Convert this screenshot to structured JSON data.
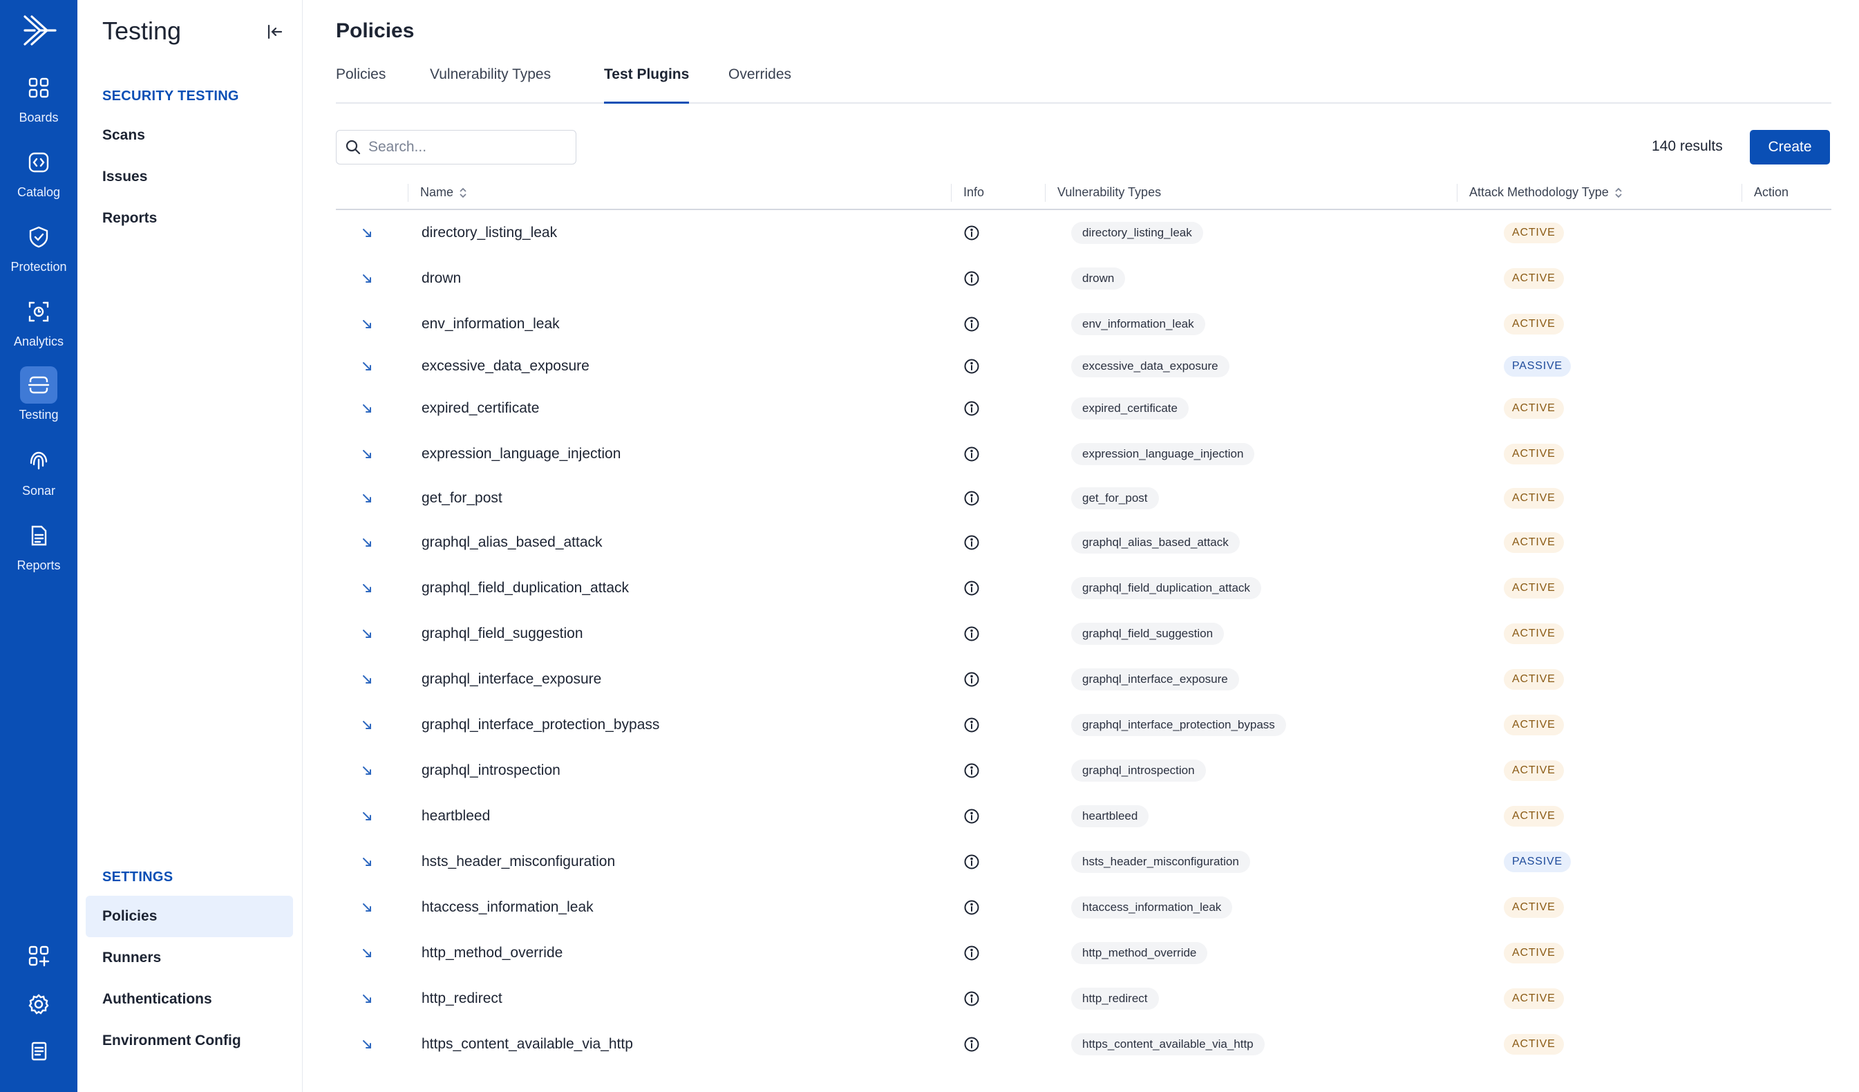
{
  "rail": {
    "items": [
      {
        "label": "Boards",
        "icon": "grid-icon"
      },
      {
        "label": "Catalog",
        "icon": "catalog-icon"
      },
      {
        "label": "Protection",
        "icon": "shield-icon"
      },
      {
        "label": "Analytics",
        "icon": "analytics-icon"
      },
      {
        "label": "Testing",
        "icon": "testing-icon",
        "active": true
      },
      {
        "label": "Sonar",
        "icon": "fingerprint-icon"
      },
      {
        "label": "Reports",
        "icon": "document-icon"
      }
    ],
    "bottom": [
      "apps-add-icon",
      "gear-icon",
      "notes-icon"
    ]
  },
  "sidebar": {
    "title": "Testing",
    "section1": "SECURITY TESTING",
    "items1": [
      "Scans",
      "Issues",
      "Reports"
    ],
    "section2": "SETTINGS",
    "items2": [
      "Policies",
      "Runners",
      "Authentications",
      "Environment Config"
    ],
    "active_item": "Policies"
  },
  "main": {
    "title": "Policies",
    "tabs": [
      "Policies",
      "Vulnerability Types",
      "Test Plugins",
      "Overrides"
    ],
    "active_tab": "Test Plugins",
    "search_placeholder": "Search...",
    "results": "140 results",
    "create_label": "Create"
  },
  "table": {
    "columns": [
      "Name",
      "Info",
      "Vulnerability Types",
      "Attack Methodology Type",
      "Action"
    ],
    "rows": [
      {
        "name": "directory_listing_leak",
        "vuln": "directory_listing_leak",
        "type": "ACTIVE"
      },
      {
        "name": "drown",
        "vuln": "drown",
        "type": "ACTIVE"
      },
      {
        "name": "env_information_leak",
        "vuln": "env_information_leak",
        "type": "ACTIVE"
      },
      {
        "name": "excessive_data_exposure",
        "vuln": "excessive_data_exposure",
        "type": "PASSIVE"
      },
      {
        "name": "expired_certificate",
        "vuln": "expired_certificate",
        "type": "ACTIVE"
      },
      {
        "name": "expression_language_injection",
        "vuln": "expression_language_injection",
        "type": "ACTIVE"
      },
      {
        "name": "get_for_post",
        "vuln": "get_for_post",
        "type": "ACTIVE"
      },
      {
        "name": "graphql_alias_based_attack",
        "vuln": "graphql_alias_based_attack",
        "type": "ACTIVE"
      },
      {
        "name": "graphql_field_duplication_attack",
        "vuln": "graphql_field_duplication_attack",
        "type": "ACTIVE"
      },
      {
        "name": "graphql_field_suggestion",
        "vuln": "graphql_field_suggestion",
        "type": "ACTIVE"
      },
      {
        "name": "graphql_interface_exposure",
        "vuln": "graphql_interface_exposure",
        "type": "ACTIVE"
      },
      {
        "name": "graphql_interface_protection_bypass",
        "vuln": "graphql_interface_protection_bypass",
        "type": "ACTIVE"
      },
      {
        "name": "graphql_introspection",
        "vuln": "graphql_introspection",
        "type": "ACTIVE"
      },
      {
        "name": "heartbleed",
        "vuln": "heartbleed",
        "type": "ACTIVE"
      },
      {
        "name": "hsts_header_misconfiguration",
        "vuln": "hsts_header_misconfiguration",
        "type": "PASSIVE"
      },
      {
        "name": "htaccess_information_leak",
        "vuln": "htaccess_information_leak",
        "type": "ACTIVE"
      },
      {
        "name": "http_method_override",
        "vuln": "http_method_override",
        "type": "ACTIVE"
      },
      {
        "name": "http_redirect",
        "vuln": "http_redirect",
        "type": "ACTIVE"
      },
      {
        "name": "https_content_available_via_http",
        "vuln": "https_content_available_via_http",
        "type": "ACTIVE"
      }
    ]
  },
  "colors": {
    "brand": "#0a4fb5",
    "active_badge": "#fcf3e6",
    "passive_badge": "#e7effc"
  }
}
